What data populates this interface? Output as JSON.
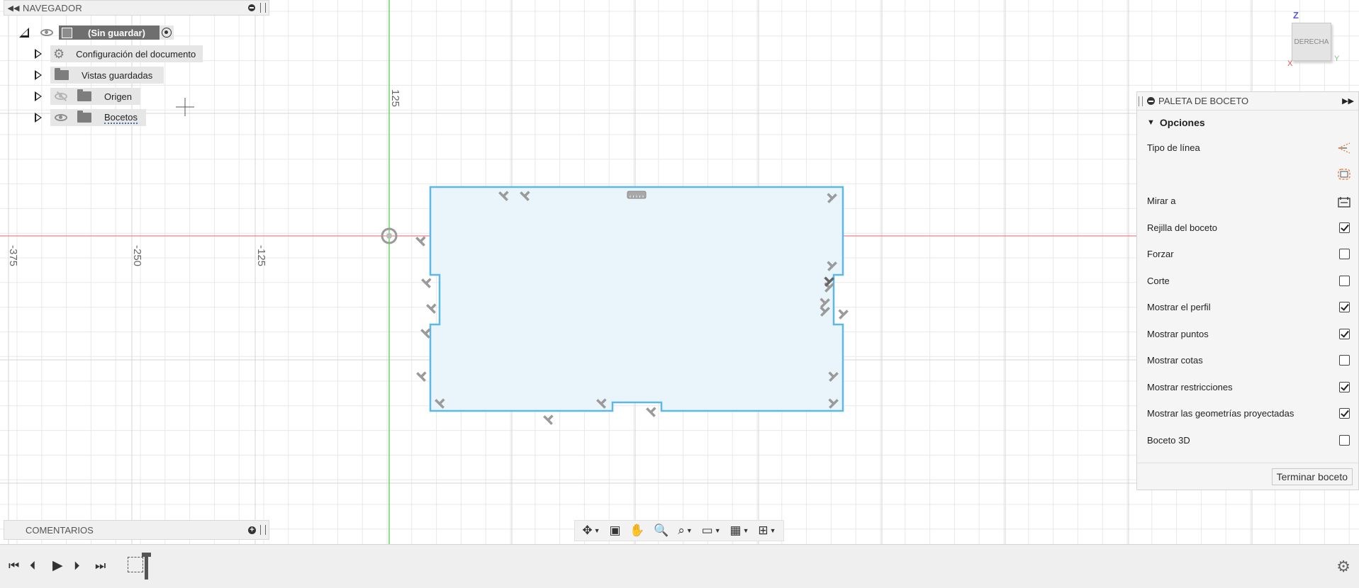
{
  "navigator": {
    "title": "NAVEGADOR",
    "root_label": "(Sin guardar)",
    "items": [
      {
        "label": "Configuración del documento",
        "icon": "gear-icon"
      },
      {
        "label": "Vistas guardadas",
        "icon": "folder-icon"
      },
      {
        "label": "Origen",
        "icon": "folder-icon",
        "visibility": "hidden"
      },
      {
        "label": "Bocetos",
        "icon": "folder-icon",
        "visibility": "visible"
      }
    ]
  },
  "canvas": {
    "axis_labels": {
      "x": [
        "-375",
        "-250",
        "-125"
      ],
      "y": [
        "125"
      ]
    },
    "colors": {
      "x_axis": "#f08080",
      "y_axis": "#5cd65c",
      "profile_fill": "#eaf4fb",
      "profile_stroke": "#5cb8e6",
      "grid": "#e8e8e8"
    }
  },
  "viewcube": {
    "face_label": "DERECHA",
    "axis_z": "Z",
    "axis_y": "Y",
    "axis_x": "X"
  },
  "palette": {
    "title": "PALETA DE BOCETO",
    "section": "Opciones",
    "rows": [
      {
        "label": "Tipo de línea",
        "control": "linetype-icon"
      },
      {
        "label": "",
        "control": "fillet-icon"
      },
      {
        "label": "Mirar a",
        "control": "look-at-icon"
      },
      {
        "label": "Rejilla del boceto",
        "checked": true
      },
      {
        "label": "Forzar",
        "checked": false
      },
      {
        "label": "Corte",
        "checked": false
      },
      {
        "label": "Mostrar el perfil",
        "checked": true
      },
      {
        "label": "Mostrar puntos",
        "checked": true
      },
      {
        "label": "Mostrar cotas",
        "checked": false
      },
      {
        "label": "Mostrar restricciones",
        "checked": true
      },
      {
        "label": "Mostrar las geometrías proyectadas",
        "checked": true
      },
      {
        "label": "Boceto 3D",
        "checked": false
      }
    ],
    "finish_label": "Terminar boceto"
  },
  "comments": {
    "title": "COMENTARIOS"
  },
  "nav_toolbar": {
    "tools": [
      "orbit-icon",
      "look-at-icon",
      "pan-icon",
      "zoom-icon",
      "fit-icon",
      "display-icon",
      "grid-icon",
      "viewports-icon"
    ]
  },
  "timeline": {
    "controls": [
      "first-icon",
      "previous-icon",
      "play-icon",
      "next-icon",
      "last-icon"
    ]
  }
}
